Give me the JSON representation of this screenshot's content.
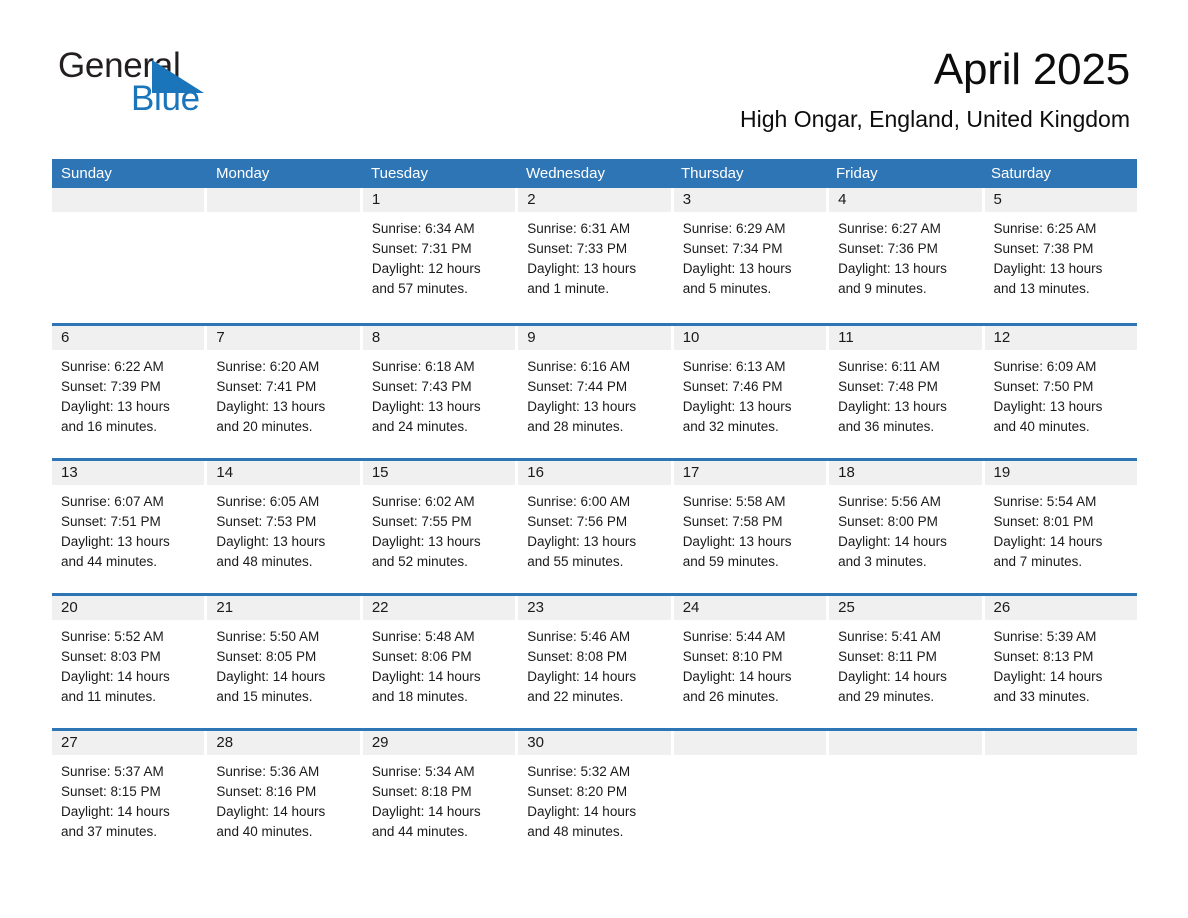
{
  "brand": {
    "name_part1": "General",
    "name_part2": "Blue",
    "triangle_color": "#1b75bb",
    "logo_icon": "general-blue-triangle-icon"
  },
  "header": {
    "title": "April 2025",
    "subtitle": "High Ongar, England, United Kingdom"
  },
  "theme": {
    "header_blue": "#2e75b6",
    "brand_blue": "#1b75bb",
    "date_band_gray": "#f0f0f0",
    "text_color": "#1a1a1a",
    "background": "#ffffff"
  },
  "calendar": {
    "weekdays": [
      "Sunday",
      "Monday",
      "Tuesday",
      "Wednesday",
      "Thursday",
      "Friday",
      "Saturday"
    ],
    "labels": {
      "sunrise_prefix": "Sunrise:",
      "sunset_prefix": "Sunset:",
      "daylight_prefix": "Daylight:"
    },
    "weeks": [
      {
        "days": [
          {
            "date": "",
            "empty": true,
            "sunrise": "",
            "sunset": "",
            "daylight_line1": "",
            "daylight_line2": ""
          },
          {
            "date": "",
            "empty": true,
            "sunrise": "",
            "sunset": "",
            "daylight_line1": "",
            "daylight_line2": ""
          },
          {
            "date": "1",
            "empty": false,
            "sunrise": "Sunrise: 6:34 AM",
            "sunset": "Sunset: 7:31 PM",
            "daylight_line1": "Daylight: 12 hours",
            "daylight_line2": "and 57 minutes."
          },
          {
            "date": "2",
            "empty": false,
            "sunrise": "Sunrise: 6:31 AM",
            "sunset": "Sunset: 7:33 PM",
            "daylight_line1": "Daylight: 13 hours",
            "daylight_line2": "and 1 minute."
          },
          {
            "date": "3",
            "empty": false,
            "sunrise": "Sunrise: 6:29 AM",
            "sunset": "Sunset: 7:34 PM",
            "daylight_line1": "Daylight: 13 hours",
            "daylight_line2": "and 5 minutes."
          },
          {
            "date": "4",
            "empty": false,
            "sunrise": "Sunrise: 6:27 AM",
            "sunset": "Sunset: 7:36 PM",
            "daylight_line1": "Daylight: 13 hours",
            "daylight_line2": "and 9 minutes."
          },
          {
            "date": "5",
            "empty": false,
            "sunrise": "Sunrise: 6:25 AM",
            "sunset": "Sunset: 7:38 PM",
            "daylight_line1": "Daylight: 13 hours",
            "daylight_line2": "and 13 minutes."
          }
        ]
      },
      {
        "days": [
          {
            "date": "6",
            "empty": false,
            "sunrise": "Sunrise: 6:22 AM",
            "sunset": "Sunset: 7:39 PM",
            "daylight_line1": "Daylight: 13 hours",
            "daylight_line2": "and 16 minutes."
          },
          {
            "date": "7",
            "empty": false,
            "sunrise": "Sunrise: 6:20 AM",
            "sunset": "Sunset: 7:41 PM",
            "daylight_line1": "Daylight: 13 hours",
            "daylight_line2": "and 20 minutes."
          },
          {
            "date": "8",
            "empty": false,
            "sunrise": "Sunrise: 6:18 AM",
            "sunset": "Sunset: 7:43 PM",
            "daylight_line1": "Daylight: 13 hours",
            "daylight_line2": "and 24 minutes."
          },
          {
            "date": "9",
            "empty": false,
            "sunrise": "Sunrise: 6:16 AM",
            "sunset": "Sunset: 7:44 PM",
            "daylight_line1": "Daylight: 13 hours",
            "daylight_line2": "and 28 minutes."
          },
          {
            "date": "10",
            "empty": false,
            "sunrise": "Sunrise: 6:13 AM",
            "sunset": "Sunset: 7:46 PM",
            "daylight_line1": "Daylight: 13 hours",
            "daylight_line2": "and 32 minutes."
          },
          {
            "date": "11",
            "empty": false,
            "sunrise": "Sunrise: 6:11 AM",
            "sunset": "Sunset: 7:48 PM",
            "daylight_line1": "Daylight: 13 hours",
            "daylight_line2": "and 36 minutes."
          },
          {
            "date": "12",
            "empty": false,
            "sunrise": "Sunrise: 6:09 AM",
            "sunset": "Sunset: 7:50 PM",
            "daylight_line1": "Daylight: 13 hours",
            "daylight_line2": "and 40 minutes."
          }
        ]
      },
      {
        "days": [
          {
            "date": "13",
            "empty": false,
            "sunrise": "Sunrise: 6:07 AM",
            "sunset": "Sunset: 7:51 PM",
            "daylight_line1": "Daylight: 13 hours",
            "daylight_line2": "and 44 minutes."
          },
          {
            "date": "14",
            "empty": false,
            "sunrise": "Sunrise: 6:05 AM",
            "sunset": "Sunset: 7:53 PM",
            "daylight_line1": "Daylight: 13 hours",
            "daylight_line2": "and 48 minutes."
          },
          {
            "date": "15",
            "empty": false,
            "sunrise": "Sunrise: 6:02 AM",
            "sunset": "Sunset: 7:55 PM",
            "daylight_line1": "Daylight: 13 hours",
            "daylight_line2": "and 52 minutes."
          },
          {
            "date": "16",
            "empty": false,
            "sunrise": "Sunrise: 6:00 AM",
            "sunset": "Sunset: 7:56 PM",
            "daylight_line1": "Daylight: 13 hours",
            "daylight_line2": "and 55 minutes."
          },
          {
            "date": "17",
            "empty": false,
            "sunrise": "Sunrise: 5:58 AM",
            "sunset": "Sunset: 7:58 PM",
            "daylight_line1": "Daylight: 13 hours",
            "daylight_line2": "and 59 minutes."
          },
          {
            "date": "18",
            "empty": false,
            "sunrise": "Sunrise: 5:56 AM",
            "sunset": "Sunset: 8:00 PM",
            "daylight_line1": "Daylight: 14 hours",
            "daylight_line2": "and 3 minutes."
          },
          {
            "date": "19",
            "empty": false,
            "sunrise": "Sunrise: 5:54 AM",
            "sunset": "Sunset: 8:01 PM",
            "daylight_line1": "Daylight: 14 hours",
            "daylight_line2": "and 7 minutes."
          }
        ]
      },
      {
        "days": [
          {
            "date": "20",
            "empty": false,
            "sunrise": "Sunrise: 5:52 AM",
            "sunset": "Sunset: 8:03 PM",
            "daylight_line1": "Daylight: 14 hours",
            "daylight_line2": "and 11 minutes."
          },
          {
            "date": "21",
            "empty": false,
            "sunrise": "Sunrise: 5:50 AM",
            "sunset": "Sunset: 8:05 PM",
            "daylight_line1": "Daylight: 14 hours",
            "daylight_line2": "and 15 minutes."
          },
          {
            "date": "22",
            "empty": false,
            "sunrise": "Sunrise: 5:48 AM",
            "sunset": "Sunset: 8:06 PM",
            "daylight_line1": "Daylight: 14 hours",
            "daylight_line2": "and 18 minutes."
          },
          {
            "date": "23",
            "empty": false,
            "sunrise": "Sunrise: 5:46 AM",
            "sunset": "Sunset: 8:08 PM",
            "daylight_line1": "Daylight: 14 hours",
            "daylight_line2": "and 22 minutes."
          },
          {
            "date": "24",
            "empty": false,
            "sunrise": "Sunrise: 5:44 AM",
            "sunset": "Sunset: 8:10 PM",
            "daylight_line1": "Daylight: 14 hours",
            "daylight_line2": "and 26 minutes."
          },
          {
            "date": "25",
            "empty": false,
            "sunrise": "Sunrise: 5:41 AM",
            "sunset": "Sunset: 8:11 PM",
            "daylight_line1": "Daylight: 14 hours",
            "daylight_line2": "and 29 minutes."
          },
          {
            "date": "26",
            "empty": false,
            "sunrise": "Sunrise: 5:39 AM",
            "sunset": "Sunset: 8:13 PM",
            "daylight_line1": "Daylight: 14 hours",
            "daylight_line2": "and 33 minutes."
          }
        ]
      },
      {
        "days": [
          {
            "date": "27",
            "empty": false,
            "sunrise": "Sunrise: 5:37 AM",
            "sunset": "Sunset: 8:15 PM",
            "daylight_line1": "Daylight: 14 hours",
            "daylight_line2": "and 37 minutes."
          },
          {
            "date": "28",
            "empty": false,
            "sunrise": "Sunrise: 5:36 AM",
            "sunset": "Sunset: 8:16 PM",
            "daylight_line1": "Daylight: 14 hours",
            "daylight_line2": "and 40 minutes."
          },
          {
            "date": "29",
            "empty": false,
            "sunrise": "Sunrise: 5:34 AM",
            "sunset": "Sunset: 8:18 PM",
            "daylight_line1": "Daylight: 14 hours",
            "daylight_line2": "and 44 minutes."
          },
          {
            "date": "30",
            "empty": false,
            "sunrise": "Sunrise: 5:32 AM",
            "sunset": "Sunset: 8:20 PM",
            "daylight_line1": "Daylight: 14 hours",
            "daylight_line2": "and 48 minutes."
          },
          {
            "date": "",
            "empty": true,
            "sunrise": "",
            "sunset": "",
            "daylight_line1": "",
            "daylight_line2": ""
          },
          {
            "date": "",
            "empty": true,
            "sunrise": "",
            "sunset": "",
            "daylight_line1": "",
            "daylight_line2": ""
          },
          {
            "date": "",
            "empty": true,
            "sunrise": "",
            "sunset": "",
            "daylight_line1": "",
            "daylight_line2": ""
          }
        ]
      }
    ]
  }
}
